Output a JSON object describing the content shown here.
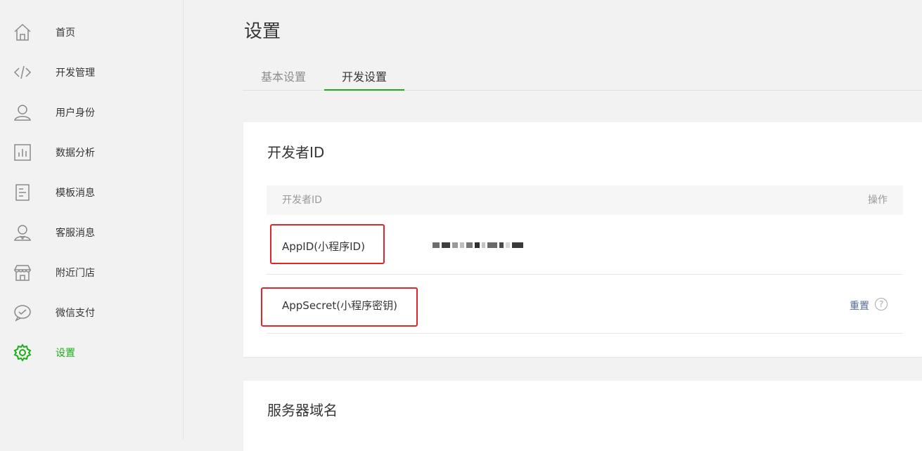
{
  "sidebar": {
    "items": [
      {
        "label": "首页",
        "icon": "home-icon"
      },
      {
        "label": "开发管理",
        "icon": "code-icon"
      },
      {
        "label": "用户身份",
        "icon": "user-icon"
      },
      {
        "label": "数据分析",
        "icon": "chart-icon"
      },
      {
        "label": "模板消息",
        "icon": "document-icon"
      },
      {
        "label": "客服消息",
        "icon": "customer-service-icon"
      },
      {
        "label": "附近门店",
        "icon": "store-icon"
      },
      {
        "label": "微信支付",
        "icon": "wechat-pay-icon"
      },
      {
        "label": "设置",
        "icon": "gear-icon",
        "active": true
      }
    ]
  },
  "page": {
    "title": "设置",
    "tabs": [
      {
        "label": "基本设置"
      },
      {
        "label": "开发设置",
        "active": true
      }
    ]
  },
  "developer_card": {
    "title": "开发者ID",
    "columns": {
      "name": "开发者ID",
      "action": "操作"
    },
    "rows": [
      {
        "label": "AppID(小程序ID)"
      },
      {
        "label": "AppSecret(小程序密钥)",
        "action": "重置",
        "help": "?"
      }
    ]
  },
  "server_card": {
    "title": "服务器域名"
  },
  "colors": {
    "accent": "#1aad19",
    "link": "#576b95",
    "highlight": "#e0262b"
  }
}
